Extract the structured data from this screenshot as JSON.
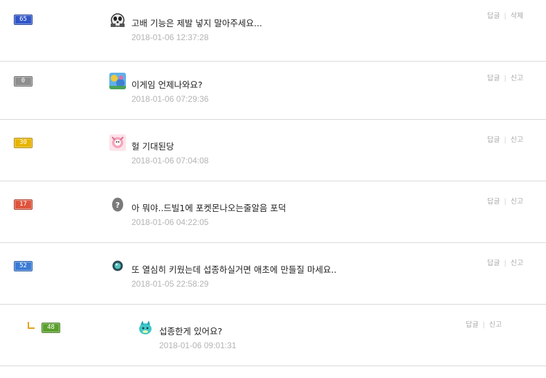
{
  "colors": {
    "accent_reply": "#e3a21a",
    "timestamp": "#b3b3b3",
    "divider": "#d9d9d9"
  },
  "comments": [
    {
      "level": "65",
      "badge_color": "#2f55c8",
      "avatar": "panda-pokemon-avatar",
      "text": "고배 기능은 제발 넣지 말아주세요...",
      "time": "2018-01-06 12:37:28",
      "action1": "답글",
      "action2": "삭제"
    },
    {
      "level": "0",
      "badge_color": "#8e8e8e",
      "avatar": "blue-flower-avatar",
      "text": "이게임 언제나와요?",
      "time": "2018-01-06 07:29:36",
      "action1": "답글",
      "action2": "신고"
    },
    {
      "level": "30",
      "badge_color": "#e8b400",
      "avatar": "pink-creature-avatar",
      "text": "헐 기대된당",
      "time": "2018-01-06 07:04:08",
      "action1": "답글",
      "action2": "신고"
    },
    {
      "level": "17",
      "badge_color": "#e0533b",
      "avatar": "question-mark-avatar",
      "text": "아 뭐야..드빌1에 포켓몬나오는줄알음 포덕",
      "time": "2018-01-06 04:22:05",
      "action1": "답글",
      "action2": "신고"
    },
    {
      "level": "52",
      "badge_color": "#3a7bd5",
      "avatar": "teal-orb-avatar",
      "text": "또 열심히 키웠는데 섭종하실거면 애초에 만들질 마세요..",
      "time": "2018-01-05 22:58:29",
      "action1": "답글",
      "action2": "신고"
    },
    {
      "level": "48",
      "badge_color": "#5aa02c",
      "avatar": "cyan-dragon-avatar",
      "text": "섭종한게 있어요?",
      "time": "2018-01-06 09:01:31",
      "action1": "답글",
      "action2": "신고",
      "is_reply": true
    }
  ]
}
